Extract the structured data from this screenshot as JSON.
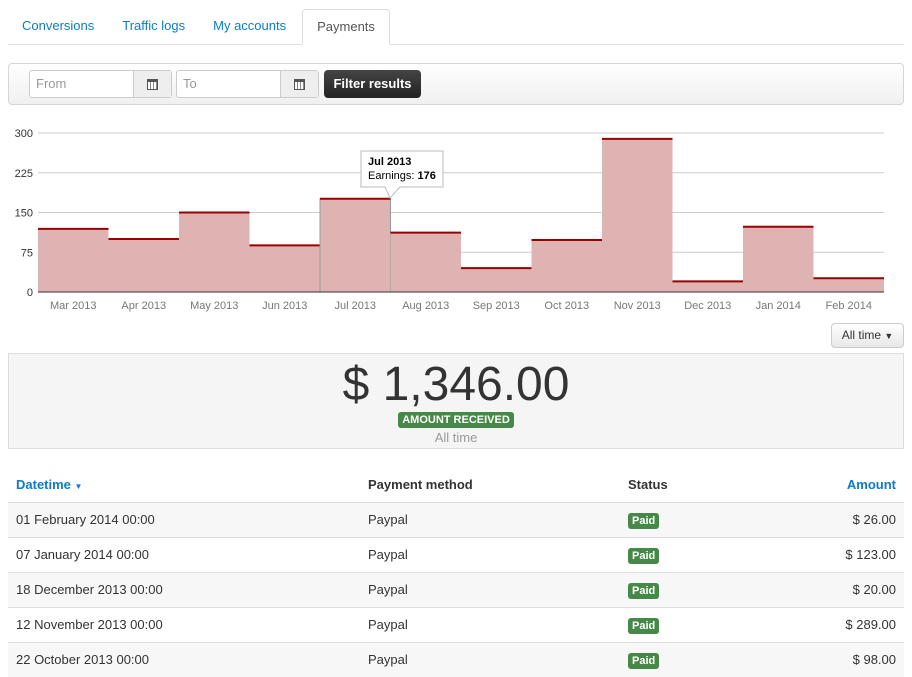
{
  "tabs": [
    {
      "label": "Conversions"
    },
    {
      "label": "Traffic logs"
    },
    {
      "label": "My accounts"
    },
    {
      "label": "Payments",
      "active": true
    }
  ],
  "filter": {
    "from_placeholder": "From",
    "to_placeholder": "To",
    "button": "Filter results"
  },
  "chart_data": {
    "type": "bar",
    "categories": [
      "Mar 2013",
      "Apr 2013",
      "May 2013",
      "Jun 2013",
      "Jul 2013",
      "Aug 2013",
      "Sep 2013",
      "Oct 2013",
      "Nov 2013",
      "Dec 2013",
      "Jan 2014",
      "Feb 2014"
    ],
    "values": [
      119,
      100,
      150,
      88,
      176,
      112,
      45,
      98,
      289,
      20,
      123,
      26
    ],
    "yticks": [
      0,
      75,
      150,
      225,
      300
    ],
    "ylim": [
      0,
      300
    ],
    "grid": true,
    "series": [
      {
        "name": "Earnings"
      }
    ],
    "tooltip": {
      "title": "Jul 2013",
      "label": "Earnings: ",
      "value": "176"
    },
    "colors": {
      "fill": "#e0b3b3",
      "line": "#990000"
    }
  },
  "range_dropdown": "All time",
  "summary": {
    "amount": "$ 1,346.00",
    "badge": "AMOUNT RECEIVED",
    "period": "All time"
  },
  "table": {
    "headers": [
      "Datetime",
      "Payment method",
      "Status",
      "Amount"
    ],
    "rows": [
      [
        "01 February 2014 00:00",
        "Paypal",
        "Paid",
        "$ 26.00"
      ],
      [
        "07 January 2014 00:00",
        "Paypal",
        "Paid",
        "$ 123.00"
      ],
      [
        "18 December 2013 00:00",
        "Paypal",
        "Paid",
        "$ 20.00"
      ],
      [
        "12 November 2013 00:00",
        "Paypal",
        "Paid",
        "$ 289.00"
      ],
      [
        "22 October 2013 00:00",
        "Paypal",
        "Paid",
        "$ 98.00"
      ]
    ]
  }
}
